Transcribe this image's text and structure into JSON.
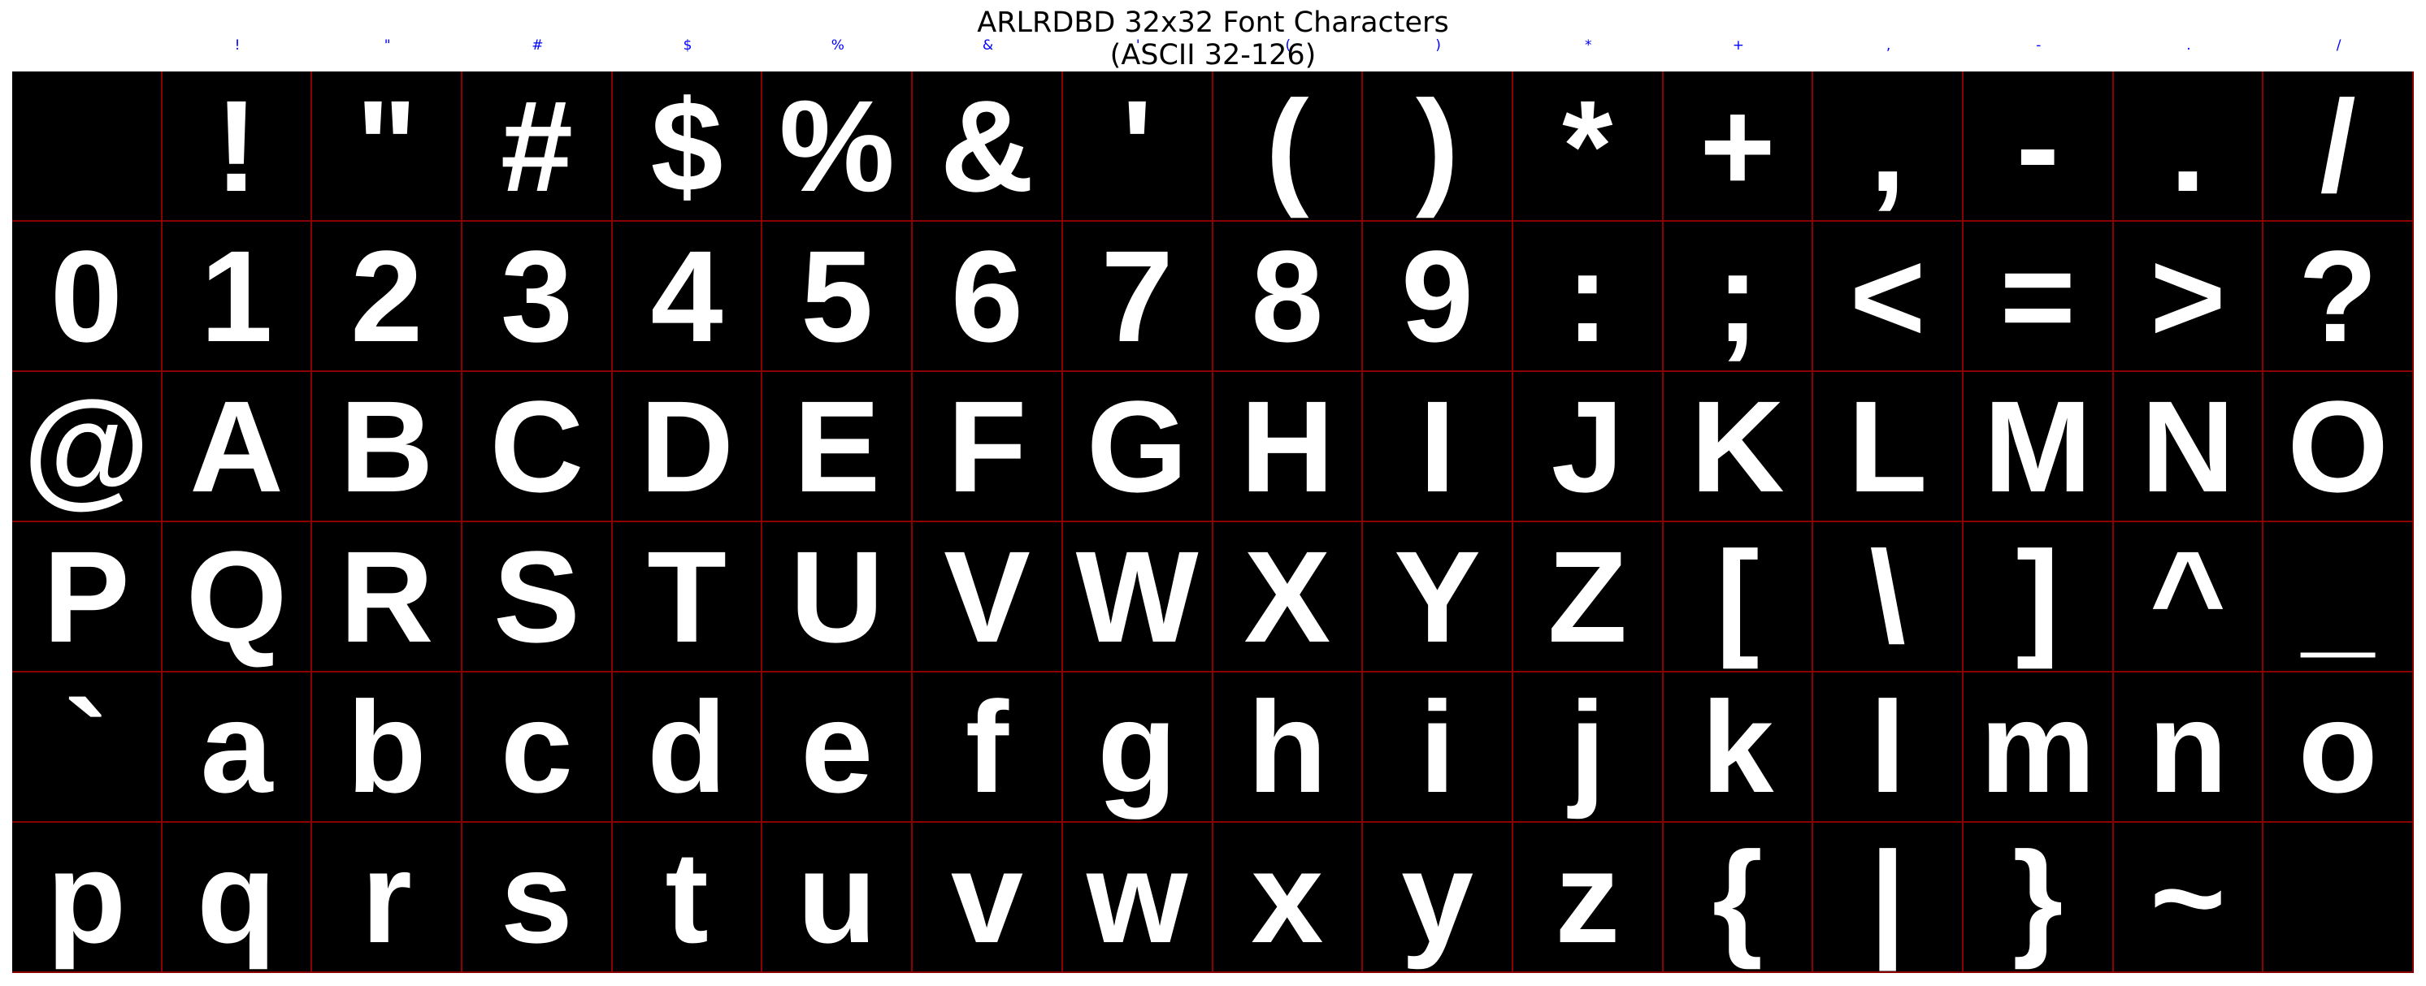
{
  "title": {
    "line1": "ARLRDBD 32x32 Font Characters",
    "line2": "(ASCII 32-126)"
  },
  "column_labels": [
    "",
    "!",
    "\"",
    "#",
    "$",
    "%",
    "&",
    "'",
    "(",
    ")",
    "*",
    "+",
    ",",
    "-",
    ".",
    "/"
  ],
  "grid": {
    "cols": 16,
    "rows": 6,
    "background": "#000000",
    "glyph_color": "#ffffff",
    "line_color": "#8b0000",
    "label_color": "#0000ff",
    "cells": [
      " ",
      "!",
      "\"",
      "#",
      "$",
      "%",
      "&",
      "'",
      "(",
      ")",
      "*",
      "+",
      ",",
      "-",
      ".",
      "/",
      "0",
      "1",
      "2",
      "3",
      "4",
      "5",
      "6",
      "7",
      "8",
      "9",
      ":",
      ";",
      "<",
      "=",
      ">",
      "?",
      "@",
      "A",
      "B",
      "C",
      "D",
      "E",
      "F",
      "G",
      "H",
      "I",
      "J",
      "K",
      "L",
      "M",
      "N",
      "O",
      "P",
      "Q",
      "R",
      "S",
      "T",
      "U",
      "V",
      "W",
      "X",
      "Y",
      "Z",
      "[",
      "\\",
      "]",
      "^",
      "_",
      "`",
      "a",
      "b",
      "c",
      "d",
      "e",
      "f",
      "g",
      "h",
      "i",
      "j",
      "k",
      "l",
      "m",
      "n",
      "o",
      "p",
      "q",
      "r",
      "s",
      "t",
      "u",
      "v",
      "w",
      "x",
      "y",
      "z",
      "{",
      "|",
      "}",
      "~",
      ""
    ]
  }
}
